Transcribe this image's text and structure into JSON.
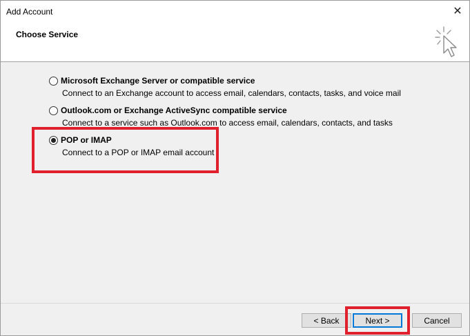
{
  "window": {
    "title": "Add Account",
    "close_glyph": "✕",
    "header_title": "Choose Service",
    "header_icon": "cursor-click-icon"
  },
  "options": [
    {
      "label": "Microsoft Exchange Server or compatible service",
      "description": "Connect to an Exchange account to access email, calendars, contacts, tasks, and voice mail",
      "selected": false
    },
    {
      "label": "Outlook.com or Exchange ActiveSync compatible service",
      "description": "Connect to a service such as Outlook.com to access email, calendars, contacts, and tasks",
      "selected": false
    },
    {
      "label": "POP or IMAP",
      "description": "Connect to a POP or IMAP email account",
      "selected": true
    }
  ],
  "buttons": {
    "back": "< Back",
    "next": "Next >",
    "cancel": "Cancel"
  },
  "colors": {
    "highlight": "#e0202c",
    "default_button_border": "#0078d7",
    "window_bg": "#f0f0f0"
  }
}
